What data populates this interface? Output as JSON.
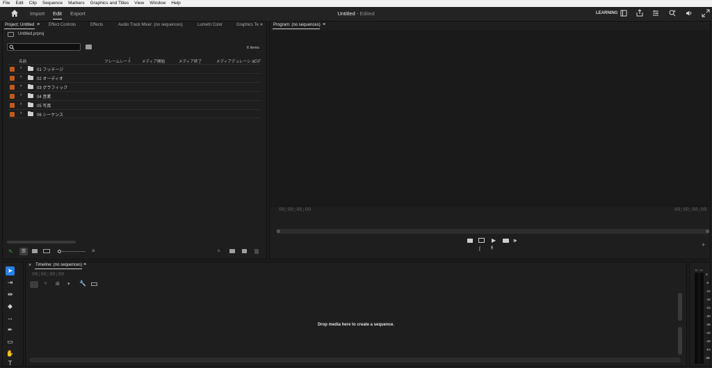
{
  "menu": [
    "File",
    "Edit",
    "Clip",
    "Sequence",
    "Markers",
    "Graphics and Titles",
    "View",
    "Window",
    "Help"
  ],
  "header": {
    "tabs": [
      "Import",
      "Edit",
      "Export"
    ],
    "title": "Untitled",
    "title_suffix": " - Edited",
    "learning": "LEARNING"
  },
  "project_panel": {
    "tabs": [
      "Project: Untitled",
      "Effect Controls",
      "Effects",
      "Audio Track Mixer: (no sequences)",
      "Lumetri Color",
      "Graphics Te"
    ],
    "file_name": "Untitled.prproj",
    "search_placeholder": "",
    "item_count": "6 items",
    "columns": [
      "名前",
      "フレームレート",
      "メディア開始",
      "メディア終了",
      "メディアデュレーション",
      "ビデ"
    ],
    "items": [
      "01 フッテージ",
      "02 オーディオ",
      "03 グラフィック",
      "04 音素",
      "05 写真",
      "06 シーケンス"
    ]
  },
  "program_panel": {
    "title": "Program: (no sequences)",
    "timecode_left": "00;00;00;00",
    "timecode_right": "00;00;00;00"
  },
  "timeline_panel": {
    "title": "Timeline: (no sequences)",
    "timecode": "00;00;00;00",
    "drop_message": "Drop media here to create a sequence."
  },
  "audio_meter": {
    "ticks": [
      "0",
      "-6",
      "-12",
      "-18",
      "-24",
      "-30",
      "-36",
      "-42",
      "-48",
      "-54",
      "dB"
    ]
  },
  "colors": {
    "label_orange": "#c2591c",
    "selection_blue": "#2680eb",
    "background": "#1d1d1d"
  }
}
